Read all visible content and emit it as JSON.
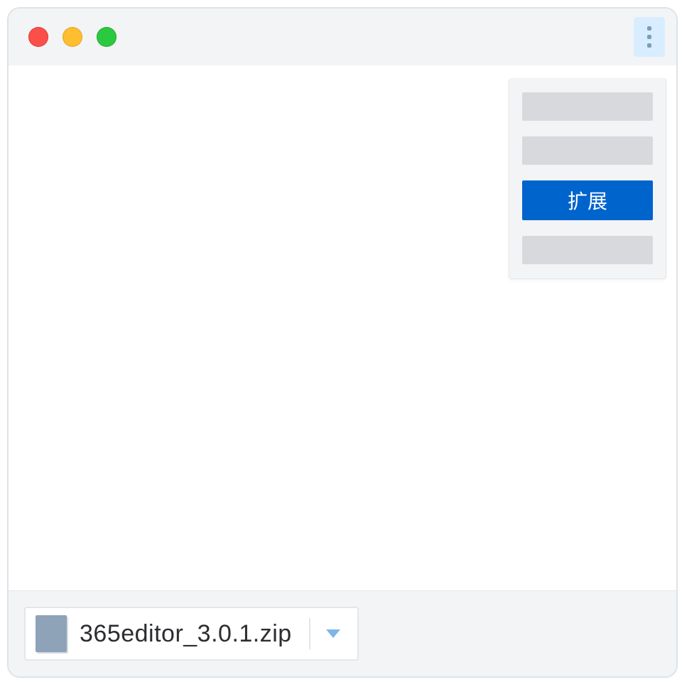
{
  "menu": {
    "items": [
      {
        "label": "",
        "selected": false
      },
      {
        "label": "",
        "selected": false
      },
      {
        "label": "扩展",
        "selected": true
      },
      {
        "label": "",
        "selected": false
      }
    ]
  },
  "download": {
    "filename": "365editor_3.0.1.zip"
  },
  "colors": {
    "accent_blue": "#0064cd",
    "menu_highlight": "#d8edff"
  }
}
